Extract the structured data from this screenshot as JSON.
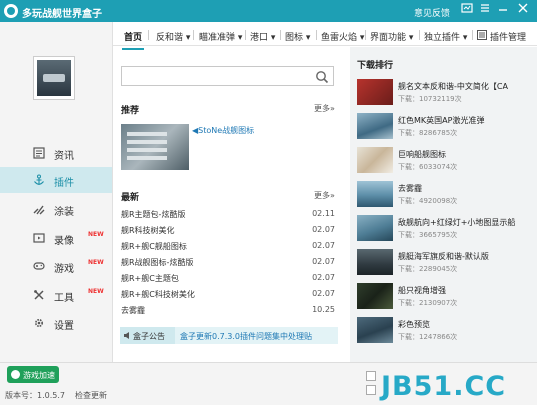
{
  "window": {
    "title": "多玩战舰世界盒子",
    "feedback": "意见反馈"
  },
  "sidebar": {
    "items": [
      {
        "label": "资讯",
        "icon": "newspaper-icon",
        "badge": ""
      },
      {
        "label": "插件",
        "icon": "anchor-icon",
        "badge": ""
      },
      {
        "label": "涂装",
        "icon": "brush-icon",
        "badge": ""
      },
      {
        "label": "录像",
        "icon": "video-icon",
        "badge": "NEW"
      },
      {
        "label": "游戏",
        "icon": "gamepad-icon",
        "badge": "NEW"
      },
      {
        "label": "工具",
        "icon": "tools-icon",
        "badge": "NEW"
      },
      {
        "label": "设置",
        "icon": "gear-icon",
        "badge": ""
      }
    ],
    "active_index": 1
  },
  "tabs": [
    {
      "label": "首页"
    },
    {
      "label": "反和谐 ▾"
    },
    {
      "label": "瞄准准弹 ▾"
    },
    {
      "label": "港口 ▾"
    },
    {
      "label": "图标 ▾"
    },
    {
      "label": "鱼雷火焰 ▾"
    },
    {
      "label": "界面功能 ▾"
    },
    {
      "label": "独立插件 ▾"
    },
    {
      "label": "插件管理"
    }
  ],
  "search": {
    "value": "",
    "placeholder": ""
  },
  "recommend": {
    "title": "推荐",
    "more": "更多»",
    "item_title": "◀StoNe战舰图标"
  },
  "latest": {
    "title": "最新",
    "more": "更多»",
    "items": [
      {
        "title": "舰R主题包-炫酷版",
        "date": "02.11"
      },
      {
        "title": "舰R科技树美化",
        "date": "02.07"
      },
      {
        "title": "舰R+舰C舰船图标",
        "date": "02.07"
      },
      {
        "title": "舰R战舰图标-炫酷版",
        "date": "02.07"
      },
      {
        "title": "舰R+舰C主题包",
        "date": "02.07"
      },
      {
        "title": "舰R+舰C科技树美化",
        "date": "02.07"
      },
      {
        "title": "去雾霾",
        "date": "10.25"
      }
    ]
  },
  "notice": {
    "button": "盒子公告",
    "text": "盒子更新0.7.3.0插件问题集中处理贴"
  },
  "downloads": {
    "title": "下载排行",
    "items": [
      {
        "title": "舰名文本反和谐-中文简化【CA",
        "count": "下载：10732119次"
      },
      {
        "title": "红色MK英国AP激光准弹",
        "count": "下载：8286785次"
      },
      {
        "title": "巨响船舰图标",
        "count": "下载：6033074次"
      },
      {
        "title": "去雾霾",
        "count": "下载：4920098次"
      },
      {
        "title": "敌舰航向+红绿灯+小地图显示船",
        "count": "下载：3665795次"
      },
      {
        "title": "舰艇海军旗反和谐-默认版",
        "count": "下载：2289045次"
      },
      {
        "title": "船只视角增强",
        "count": "下载：2130907次"
      },
      {
        "title": "彩色预览",
        "count": "下载：1247866次"
      }
    ]
  },
  "bottom": {
    "game_button": "游戏加速",
    "version": "版本号：1.0.5.7",
    "check_update": "检查更新"
  },
  "watermark": "JB51.CC",
  "colors": {
    "accent": "#1e9fb4",
    "link": "#1e78b4",
    "game_button": "#1fa05a",
    "watermark": "#27a9c7"
  }
}
